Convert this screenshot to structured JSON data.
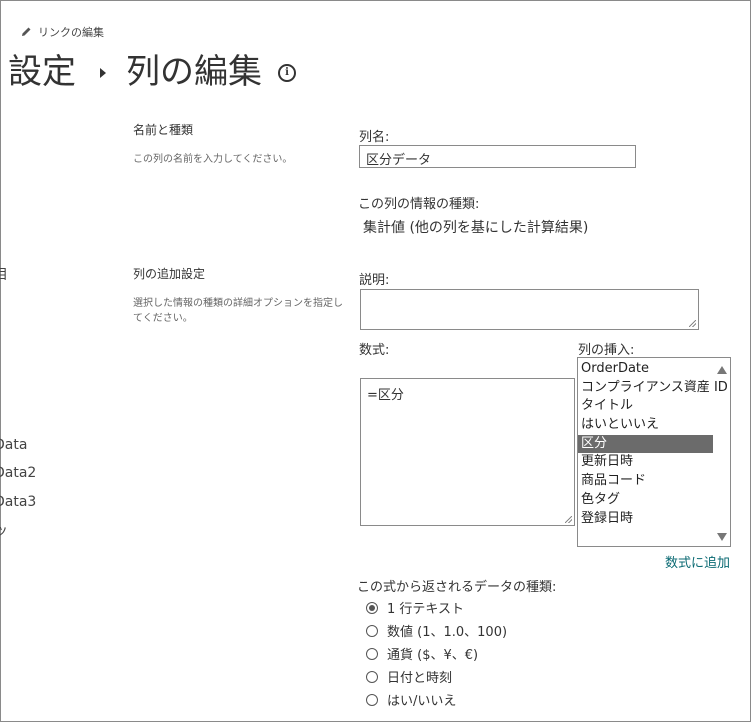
{
  "header": {
    "edit_links_label": "リンクの編集",
    "breadcrumb": [
      "設定",
      "列の編集"
    ]
  },
  "nav": {
    "items": [
      "目",
      "Data",
      "Data2",
      "Data3",
      "ッ"
    ]
  },
  "sections": {
    "name_type": {
      "title": "名前と種類",
      "description": "この列の名前を入力してください。"
    },
    "additional": {
      "title": "列の追加設定",
      "description": "選択した情報の種類の詳細オプションを指定してください。"
    }
  },
  "form": {
    "column_name_label": "列名:",
    "column_name_value": "区分データ",
    "info_type_label": "この列の情報の種類:",
    "info_type_value": "集計値 (他の列を基にした計算結果)",
    "description_label": "説明:",
    "description_value": "",
    "formula_label": "数式:",
    "formula_value": "=区分",
    "insert_column_label": "列の挿入:",
    "insert_columns": [
      "OrderDate",
      "コンプライアンス資産 ID",
      "タイトル",
      "はいといいえ",
      "区分",
      "更新日時",
      "商品コード",
      "色タグ",
      "登録日時"
    ],
    "selected_insert_column": "区分",
    "add_to_formula_link": "数式に追加",
    "return_type_label": "この式から返されるデータの種類:",
    "return_types": [
      "1 行テキスト",
      "数値 (1、1.0、100)",
      "通貨 ($、¥、€)",
      "日付と時刻",
      "はい/いいえ"
    ],
    "selected_return_type": "1 行テキスト"
  },
  "colors": {
    "link": "#0b6a73",
    "selected_item_bg": "#6b6b6b",
    "text": "#333333"
  }
}
